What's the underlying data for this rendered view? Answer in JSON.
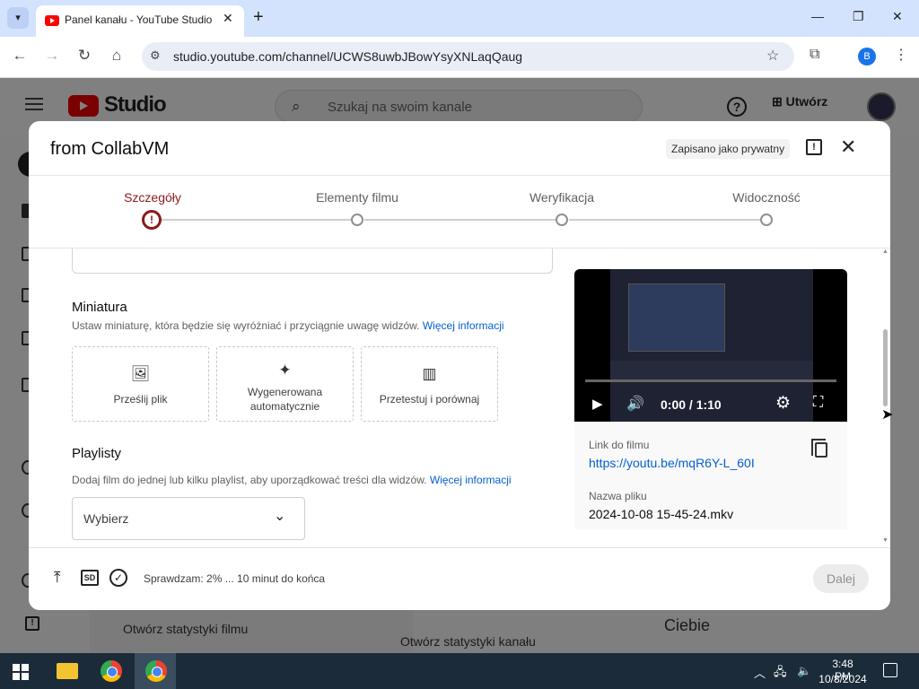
{
  "browser": {
    "tab_title": "Panel kanału - YouTube Studio",
    "url": "studio.youtube.com/channel/UCWS8uwbJBowYsyXNLaqQaug",
    "profile_initial": "B"
  },
  "studio": {
    "logo_text": "Studio",
    "search_placeholder": "Szukaj na swoim kanale",
    "create_label": "Utwórz",
    "video_stats_btn": "Otwórz statystyki filmu",
    "channel_stats_btn": "Otwórz statystyki kanału",
    "for_you_text": "Ciebie"
  },
  "dialog": {
    "title": "from CollabVM",
    "saved_chip": "Zapisano jako prywatny",
    "steps": [
      {
        "label": "Szczegóły",
        "state": "error"
      },
      {
        "label": "Elementy filmu",
        "state": "pending"
      },
      {
        "label": "Weryfikacja",
        "state": "pending"
      },
      {
        "label": "Widoczność",
        "state": "pending"
      }
    ],
    "thumbnail": {
      "title": "Miniatura",
      "desc": "Ustaw miniaturę, która będzie się wyróżniać i przyciągnie uwagę widzów.",
      "more": "Więcej informacji",
      "options": [
        {
          "label": "Prześlij plik",
          "icon": "add-photo-icon"
        },
        {
          "label1": "Wygenerowana",
          "label2": "automatycznie",
          "icon": "sparkle-icon"
        },
        {
          "label": "Przetestuj i porównaj",
          "icon": "chart-icon"
        }
      ]
    },
    "playlists": {
      "title": "Playlisty",
      "desc": "Dodaj film do jednej lub kilku playlist, aby uporządkować treści dla widzów.",
      "more": "Więcej informacji",
      "select_value": "Wybierz"
    },
    "preview": {
      "time": "0:00 / 1:10",
      "link_label": "Link do filmu",
      "link": "https://youtu.be/mqR6Y-L_60I",
      "file_label": "Nazwa pliku",
      "file_name": "2024-10-08 15-45-24.mkv"
    },
    "footer": {
      "sd_label": "SD",
      "status": "Sprawdzam: 2% ... 10 minut do końca",
      "next_label": "Dalej"
    }
  },
  "taskbar": {
    "time": "3:48 PM",
    "date": "10/8/2024"
  },
  "colors": {
    "accent_error": "#8b1a1a",
    "link": "#065fd4",
    "youtube_red": "#ff0000"
  }
}
